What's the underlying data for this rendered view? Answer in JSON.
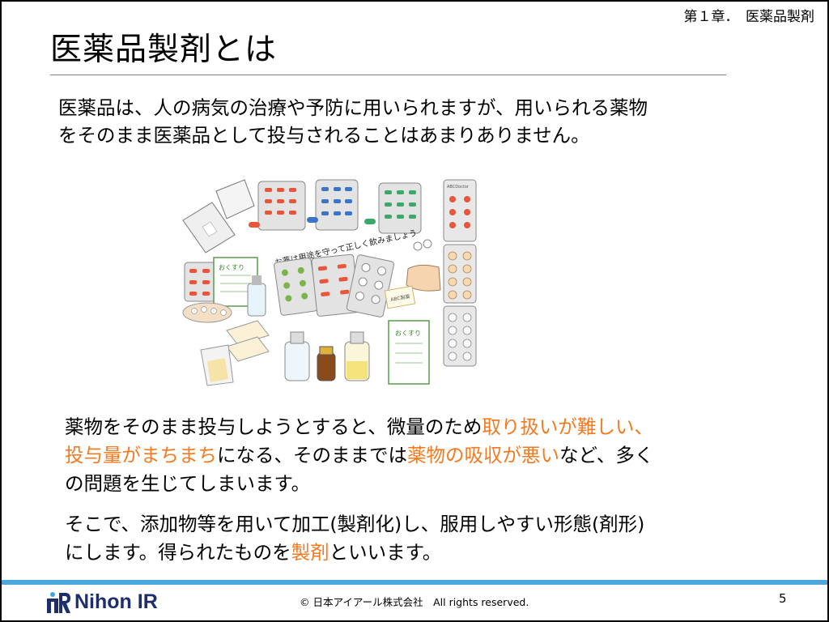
{
  "header": {
    "chapter": "第１章．　医薬品製剤"
  },
  "slide": {
    "title": "医薬品製剤とは",
    "intro_line1": "医薬品は、人の病気の治療や予防に用いられますが、用いられる薬物",
    "intro_line2": "をそのまま医薬品として投与されることはあまりありません。",
    "p1_a": "薬物をそのまま投与しようとすると、微量のため",
    "p1_hl1": "取り扱いが難しい、",
    "p1_hl2": "投与量がまちまち",
    "p1_b": "になる、そのままでは",
    "p1_hl3": "薬物の吸収が悪い",
    "p1_c": "など、多く",
    "p1_d": "の問題を生じてしまいます。",
    "p2_a": "そこで、添加物等を用いて加工(製剤化)し、服用しやすい形態(剤形)",
    "p2_b": "にします。得られたものを",
    "p2_hl": "製剤",
    "p2_c": "といいます。"
  },
  "illustration": {
    "banner": "お薬は用途を守って正しく飲みましょう",
    "bag_label_1": "おくすり",
    "bag_label_2": "おくすり",
    "card_label": "ABC製薬",
    "blister_label": "ABCDoctor"
  },
  "footer": {
    "logo_text": "Nihon IR",
    "copyright": "© 日本アイアール株式会社　All rights reserved.",
    "page_number": "5"
  },
  "colors": {
    "highlight": "#f47a20",
    "accent_bar": "#4aa6dc",
    "logo_blue": "#1c2e6c"
  }
}
